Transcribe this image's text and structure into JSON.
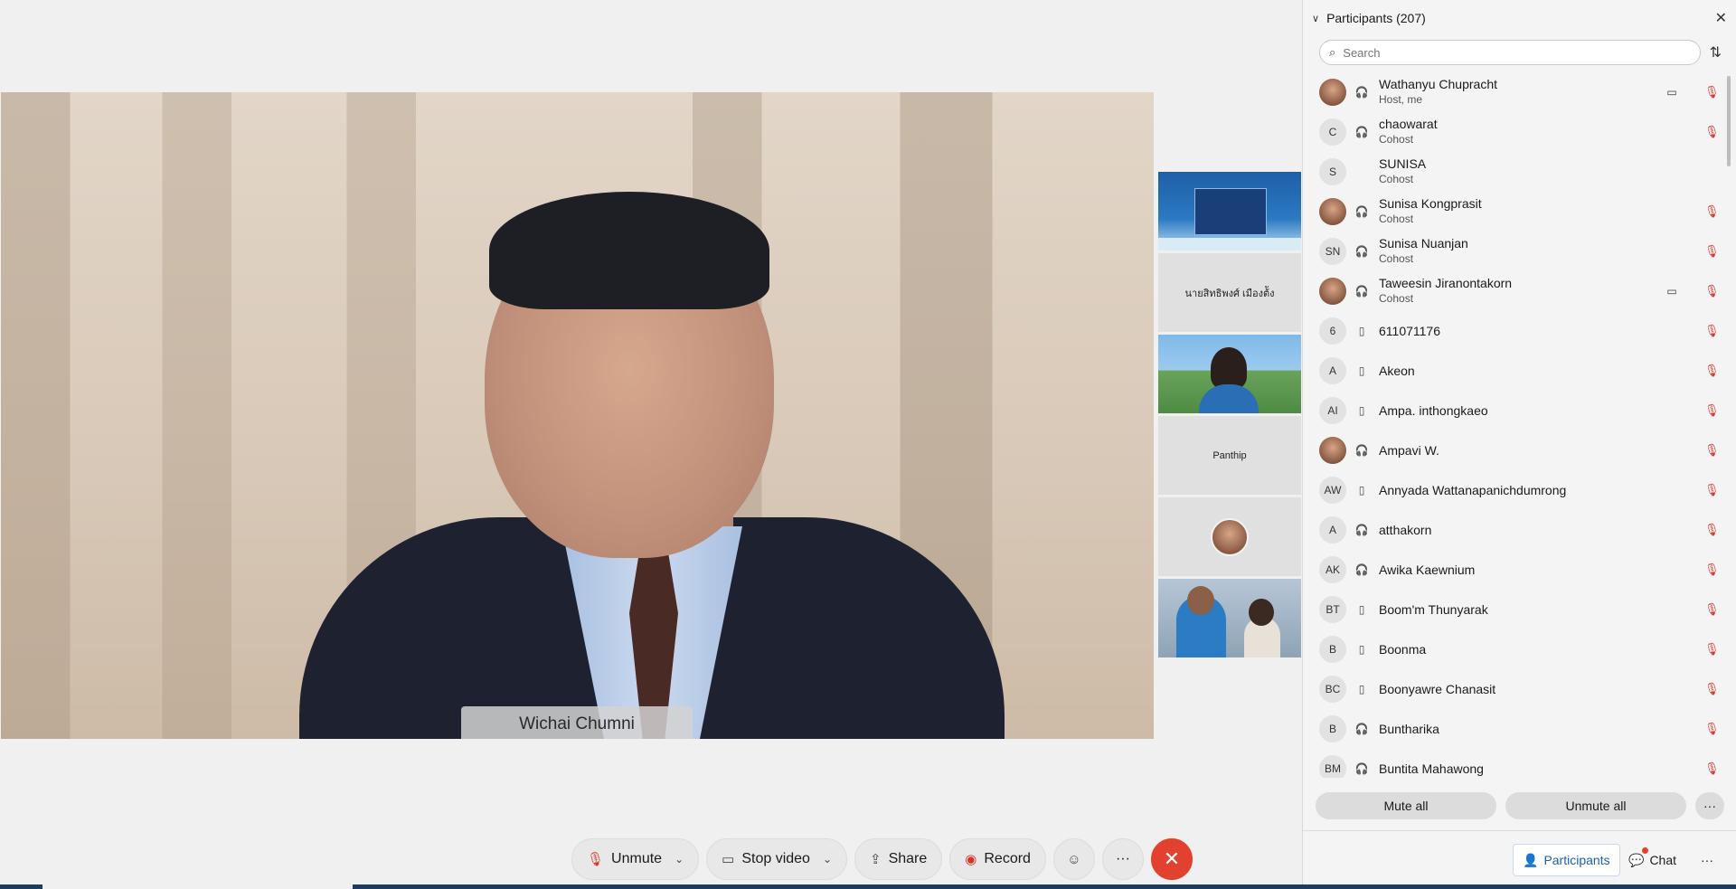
{
  "main_video": {
    "speaker_name": "Wichai Chumni"
  },
  "thumbnails": [
    {
      "type": "video"
    },
    {
      "type": "name",
      "label": "นายสิทธิพงศ์ เมืองต้ัง"
    },
    {
      "type": "video"
    },
    {
      "type": "name",
      "label": "Panthip"
    },
    {
      "type": "avatar"
    },
    {
      "type": "video"
    }
  ],
  "toolbar": {
    "unmute": "Unmute",
    "stop_video": "Stop video",
    "share": "Share",
    "record": "Record",
    "more": "···",
    "end": "✕"
  },
  "panel": {
    "title": "Participants (207)",
    "search_placeholder": "Search",
    "participants": [
      {
        "initials": "",
        "photo": true,
        "device": "headset",
        "name": "Wathanyu Chupracht",
        "role": "Host, me",
        "video": true,
        "muted": true
      },
      {
        "initials": "C",
        "photo": false,
        "device": "headset",
        "name": "chaowarat",
        "role": "Cohost",
        "video": false,
        "muted": true
      },
      {
        "initials": "S",
        "photo": false,
        "device": "",
        "name": "SUNISA",
        "role": "Cohost",
        "video": false,
        "muted": false
      },
      {
        "initials": "",
        "photo": true,
        "device": "headset",
        "name": "Sunisa Kongprasit",
        "role": "Cohost",
        "video": false,
        "muted": true
      },
      {
        "initials": "SN",
        "photo": false,
        "device": "headset",
        "name": "Sunisa Nuanjan",
        "role": "Cohost",
        "video": false,
        "muted": true
      },
      {
        "initials": "",
        "photo": true,
        "device": "headset",
        "name": "Taweesin Jiranontakorn",
        "role": "Cohost",
        "video": true,
        "muted": true
      },
      {
        "initials": "6",
        "photo": false,
        "device": "phone",
        "name": "611071176",
        "role": "",
        "video": false,
        "muted": true
      },
      {
        "initials": "A",
        "photo": false,
        "device": "phone",
        "name": "Akeon",
        "role": "",
        "video": false,
        "muted": true
      },
      {
        "initials": "AI",
        "photo": false,
        "device": "phone",
        "name": "Ampa. inthongkaeo",
        "role": "",
        "video": false,
        "muted": true
      },
      {
        "initials": "",
        "photo": true,
        "device": "headset",
        "name": "Ampavi W.",
        "role": "",
        "video": false,
        "muted": true
      },
      {
        "initials": "AW",
        "photo": false,
        "device": "phone",
        "name": "Annyada Wattanapanichdumrong",
        "role": "",
        "video": false,
        "muted": true
      },
      {
        "initials": "A",
        "photo": false,
        "device": "headset",
        "name": "atthakorn",
        "role": "",
        "video": false,
        "muted": true
      },
      {
        "initials": "AK",
        "photo": false,
        "device": "headset",
        "name": "Awika Kaewnium",
        "role": "",
        "video": false,
        "muted": true
      },
      {
        "initials": "BT",
        "photo": false,
        "device": "phone",
        "name": "Boom'm Thunyarak",
        "role": "",
        "video": false,
        "muted": true
      },
      {
        "initials": "B",
        "photo": false,
        "device": "phone",
        "name": "Boonma",
        "role": "",
        "video": false,
        "muted": true
      },
      {
        "initials": "BC",
        "photo": false,
        "device": "phone",
        "name": "Boonyawre Chanasit",
        "role": "",
        "video": false,
        "muted": true
      },
      {
        "initials": "B",
        "photo": false,
        "device": "headset",
        "name": "Buntharika",
        "role": "",
        "video": false,
        "muted": true
      },
      {
        "initials": "BM",
        "photo": false,
        "device": "headset",
        "name": "Buntita Mahawong",
        "role": "",
        "video": false,
        "muted": true
      }
    ],
    "mute_all": "Mute all",
    "unmute_all": "Unmute all",
    "more": "···",
    "footer_participants": "Participants",
    "footer_chat": "Chat",
    "footer_more": "···"
  },
  "colors": {
    "end_button": "#e2412f",
    "muted_mic": "#d9342b",
    "accent": "#1a5fb4"
  }
}
